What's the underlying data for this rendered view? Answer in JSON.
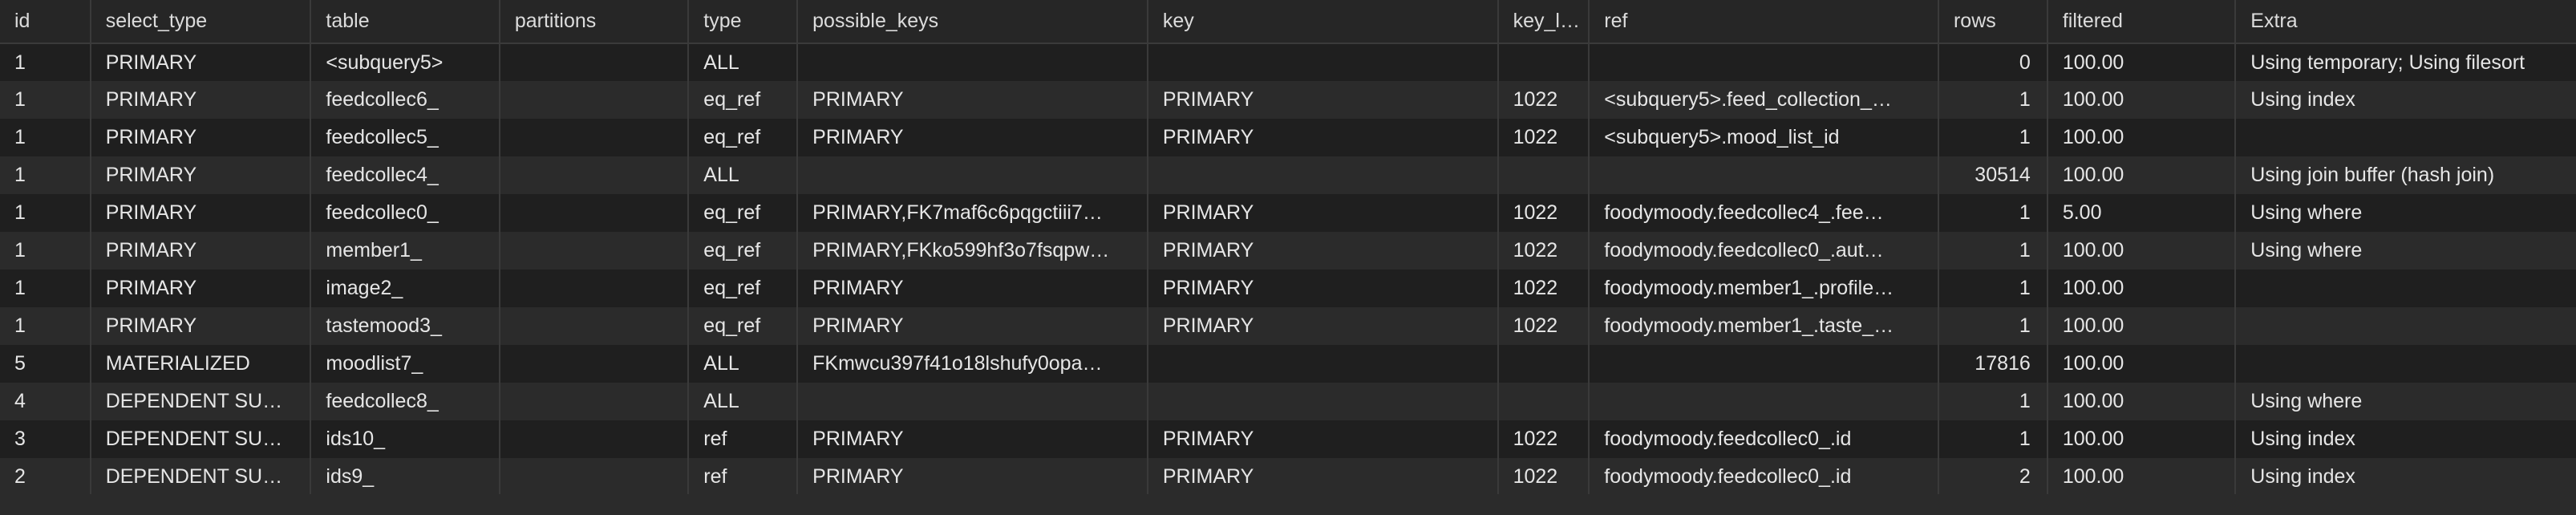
{
  "columns": [
    "id",
    "select_type",
    "table",
    "partitions",
    "type",
    "possible_keys",
    "key",
    "key_l…",
    "ref",
    "rows",
    "filtered",
    "Extra"
  ],
  "rows": [
    [
      "1",
      "PRIMARY",
      "<subquery5>",
      "",
      "ALL",
      "",
      "",
      "",
      "",
      "0",
      "100.00",
      "Using temporary; Using filesort"
    ],
    [
      "1",
      "PRIMARY",
      "feedcollec6_",
      "",
      "eq_ref",
      "PRIMARY",
      "PRIMARY",
      "1022",
      "<subquery5>.feed_collection_…",
      "1",
      "100.00",
      "Using index"
    ],
    [
      "1",
      "PRIMARY",
      "feedcollec5_",
      "",
      "eq_ref",
      "PRIMARY",
      "PRIMARY",
      "1022",
      "<subquery5>.mood_list_id",
      "1",
      "100.00",
      ""
    ],
    [
      "1",
      "PRIMARY",
      "feedcollec4_",
      "",
      "ALL",
      "",
      "",
      "",
      "",
      "30514",
      "100.00",
      "Using join buffer (hash join)"
    ],
    [
      "1",
      "PRIMARY",
      "feedcollec0_",
      "",
      "eq_ref",
      "PRIMARY,FK7maf6c6pqgctiii7…",
      "PRIMARY",
      "1022",
      "foodymoody.feedcollec4_.fee…",
      "1",
      "5.00",
      "Using where"
    ],
    [
      "1",
      "PRIMARY",
      "member1_",
      "",
      "eq_ref",
      "PRIMARY,FKko599hf3o7fsqpw…",
      "PRIMARY",
      "1022",
      "foodymoody.feedcollec0_.aut…",
      "1",
      "100.00",
      "Using where"
    ],
    [
      "1",
      "PRIMARY",
      "image2_",
      "",
      "eq_ref",
      "PRIMARY",
      "PRIMARY",
      "1022",
      "foodymoody.member1_.profile…",
      "1",
      "100.00",
      ""
    ],
    [
      "1",
      "PRIMARY",
      "tastemood3_",
      "",
      "eq_ref",
      "PRIMARY",
      "PRIMARY",
      "1022",
      "foodymoody.member1_.taste_…",
      "1",
      "100.00",
      ""
    ],
    [
      "5",
      "MATERIALIZED",
      "moodlist7_",
      "",
      "ALL",
      "FKmwcu397f41o18lshufy0opa…",
      "",
      "",
      "",
      "17816",
      "100.00",
      ""
    ],
    [
      "4",
      "DEPENDENT SU…",
      "feedcollec8_",
      "",
      "ALL",
      "",
      "",
      "",
      "",
      "1",
      "100.00",
      "Using where"
    ],
    [
      "3",
      "DEPENDENT SU…",
      "ids10_",
      "",
      "ref",
      "PRIMARY",
      "PRIMARY",
      "1022",
      "foodymoody.feedcollec0_.id",
      "1",
      "100.00",
      "Using index"
    ],
    [
      "2",
      "DEPENDENT SU…",
      "ids9_",
      "",
      "ref",
      "PRIMARY",
      "PRIMARY",
      "1022",
      "foodymoody.feedcollec0_.id",
      "2",
      "100.00",
      "Using index"
    ]
  ],
  "numeric_columns": [
    9
  ]
}
